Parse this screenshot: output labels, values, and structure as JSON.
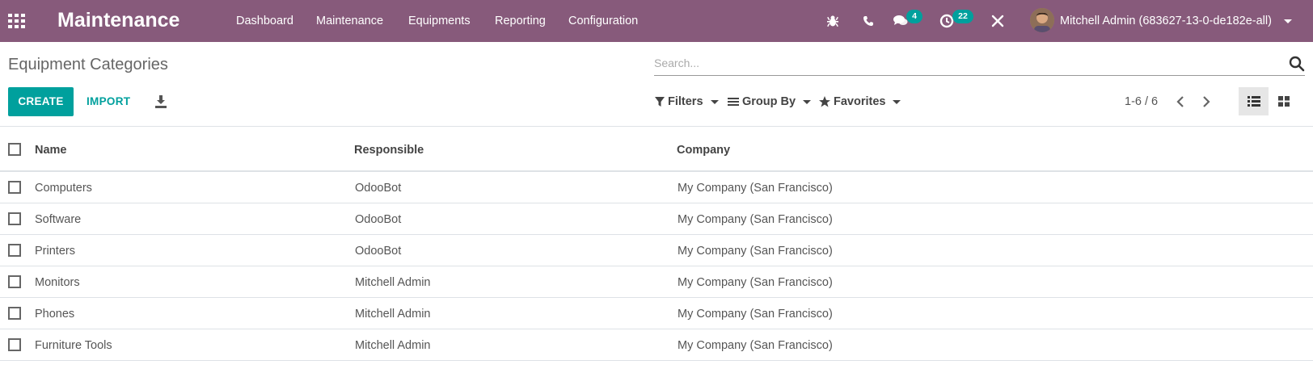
{
  "navbar": {
    "app_title": "Maintenance",
    "menu": [
      "Dashboard",
      "Maintenance",
      "Equipments",
      "Reporting",
      "Configuration"
    ],
    "messages_count": "4",
    "activities_count": "22",
    "user_name": "Mitchell Admin (683627-13-0-de182e-all)"
  },
  "control_panel": {
    "breadcrumb": "Equipment Categories",
    "search_placeholder": "Search...",
    "create_label": "CREATE",
    "import_label": "IMPORT",
    "filters_label": "Filters",
    "groupby_label": "Group By",
    "favorites_label": "Favorites",
    "pager": "1-6 / 6"
  },
  "table": {
    "columns": [
      "Name",
      "Responsible",
      "Company"
    ],
    "rows": [
      [
        "Computers",
        "OdooBot",
        "My Company (San Francisco)"
      ],
      [
        "Software",
        "OdooBot",
        "My Company (San Francisco)"
      ],
      [
        "Printers",
        "OdooBot",
        "My Company (San Francisco)"
      ],
      [
        "Monitors",
        "Mitchell Admin",
        "My Company (San Francisco)"
      ],
      [
        "Phones",
        "Mitchell Admin",
        "My Company (San Francisco)"
      ],
      [
        "Furniture Tools",
        "Mitchell Admin",
        "My Company (San Francisco)"
      ]
    ]
  },
  "colors": {
    "navbar": "#875a7b",
    "primary": "#00a09d"
  },
  "icons": {
    "apps": "apps-grid-icon",
    "debug": "bug-icon",
    "phone": "phone-icon",
    "messages": "chat-icon",
    "activities": "clock-icon",
    "tools": "tools-icon",
    "search": "search-icon",
    "download": "download-icon",
    "filter": "filter-icon",
    "groupby": "list-bars-icon",
    "favorites": "star-icon",
    "list_view": "list-view-icon",
    "kanban_view": "kanban-view-icon"
  }
}
